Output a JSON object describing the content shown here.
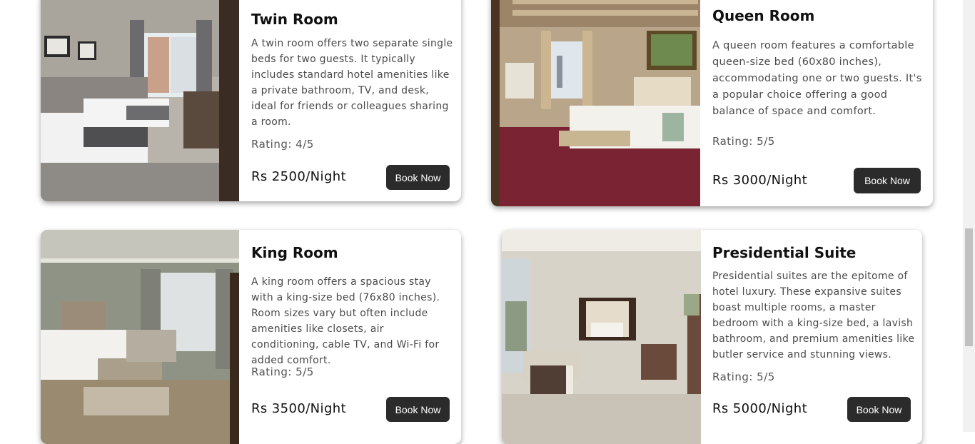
{
  "rooms": [
    {
      "title": "Twin Room",
      "description": "A twin room offers two separate single beds for two guests. It typically includes standard hotel amenities like a private bathroom, TV, and desk, ideal for friends or colleagues sharing a room.",
      "rating": "Rating: 4/5",
      "price": "Rs 2500/Night",
      "button": "Book Now"
    },
    {
      "title": "Queen Room",
      "description": "A queen room features a comfortable queen-size bed (60x80 inches), accommodating one or two guests. It's a popular choice offering a good balance of space and comfort.",
      "rating": "Rating: 5/5",
      "price": "Rs 3000/Night",
      "button": "Book Now"
    },
    {
      "title": "King Room",
      "description": "A king room offers a spacious stay with a king-size bed (76x80 inches). Room sizes vary but often include amenities like closets, air conditioning, cable TV, and Wi-Fi for added comfort.",
      "rating": "Rating: 5/5",
      "price": "Rs 3500/Night",
      "button": "Book Now"
    },
    {
      "title": "Presidential Suite",
      "description": "Presidential suites are the epitome of hotel luxury. These expansive suites boast multiple rooms, a master bedroom with a king-size bed, a lavish bathroom, and premium amenities like butler service and stunning views.",
      "rating": "Rating: 5/5",
      "price": "Rs 5000/Night",
      "button": "Book Now"
    }
  ],
  "colors": {
    "button_bg": "#2b2b2b",
    "button_text": "#ffffff",
    "page_bg": "#ffffff"
  }
}
